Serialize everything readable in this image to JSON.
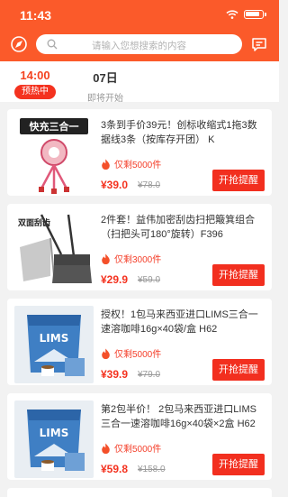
{
  "status_bar": {
    "time": "11:43"
  },
  "search": {
    "placeholder": "请输入您想搜索的内容"
  },
  "sessions": [
    {
      "time": "14:00",
      "status": "预热中"
    },
    {
      "time": "07日",
      "status": "即将开始"
    }
  ],
  "products": [
    {
      "title": "3条到手价39元！创标收缩式1拖3数据线3条（按库存开团） K",
      "stock": "仅剩5000件",
      "price": "¥39.0",
      "original_price": "¥78.0",
      "button": "开抢提醒",
      "image_text": "快充三合一"
    },
    {
      "title": "2件套！益伟加密刮齿扫把簸箕组合（扫把头可180°旋转）F396",
      "stock": "仅剩3000件",
      "price": "¥29.9",
      "original_price": "¥59.0",
      "button": "开抢提醒",
      "image_text": "双面刮齿"
    },
    {
      "title": "授权！1包马来西亚进口LIMS三合一速溶咖啡16g×40袋/盒 H62",
      "stock": "仅剩5000件",
      "price": "¥39.9",
      "original_price": "¥79.0",
      "button": "开抢提醒",
      "image_text": "LIMS"
    },
    {
      "title": "第2包半价！ 2包马来西亚进口LIMS三合一速溶咖啡16g×40袋×2盒 H62",
      "stock": "仅剩5000件",
      "price": "¥59.8",
      "original_price": "¥158.0",
      "button": "开抢提醒",
      "image_text": "LIMS"
    }
  ],
  "colors": {
    "brand": "#fb5a2a",
    "price": "#f4321f",
    "button": "#f22f1f"
  },
  "icons": [
    "compass-icon",
    "search-icon",
    "message-icon",
    "fire-icon",
    "wifi-icon",
    "battery-icon"
  ]
}
